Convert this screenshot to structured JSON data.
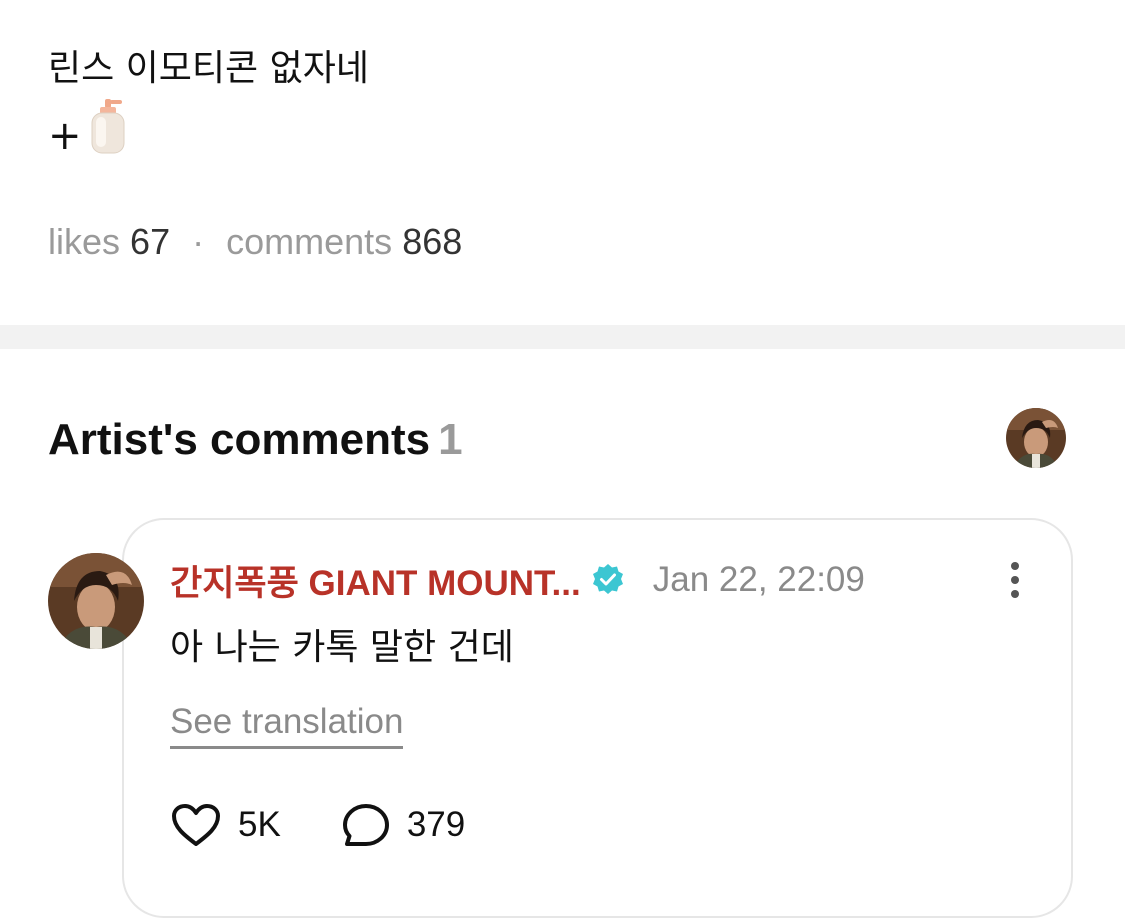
{
  "post": {
    "text_line1": "린스 이모티콘 없자네",
    "text_line2_prefix": "+",
    "emoji_icon": "lotion-bottle-icon"
  },
  "stats": {
    "likes_label": "likes",
    "likes_count": "67",
    "separator": "·",
    "comments_label": "comments",
    "comments_count": "868"
  },
  "artist_comments": {
    "title": "Artist's comments",
    "count": "1",
    "comment": {
      "author": "간지폭풍 GIANT MOUNT...",
      "verified": true,
      "date": "Jan 22, 22:09",
      "text": "아 나는 카톡 말한 건데",
      "translate_label": "See translation",
      "likes": "5K",
      "replies": "379"
    }
  },
  "colors": {
    "author": "#b83228",
    "verified": "#3cc6d2",
    "muted": "#9a9a9a",
    "divider": "#f2f2f2"
  }
}
